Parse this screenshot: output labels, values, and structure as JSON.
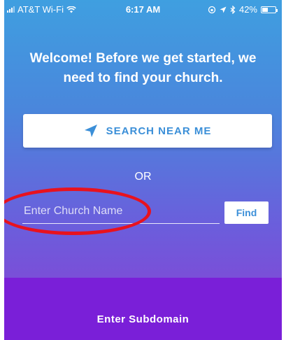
{
  "status_bar": {
    "carrier": "AT&T Wi-Fi",
    "time": "6:17 AM",
    "battery": "42%",
    "battery_level": 0.42
  },
  "welcome": {
    "line1": "Welcome! Before we get started, we",
    "line2": "need to find your church."
  },
  "search": {
    "label": "SEARCH NEAR ME",
    "icon": "location-arrow-icon"
  },
  "or_label": "OR",
  "church_input": {
    "placeholder": "Enter Church Name",
    "value": ""
  },
  "find_label": "Find",
  "subdomain_label": "Enter Subdomain",
  "colors": {
    "gradient_top": "#3f9fe0",
    "gradient_bottom": "#7a4fd8",
    "accent": "#3b8fd8",
    "footer": "#7a1fd8",
    "highlight": "#e8121e"
  }
}
